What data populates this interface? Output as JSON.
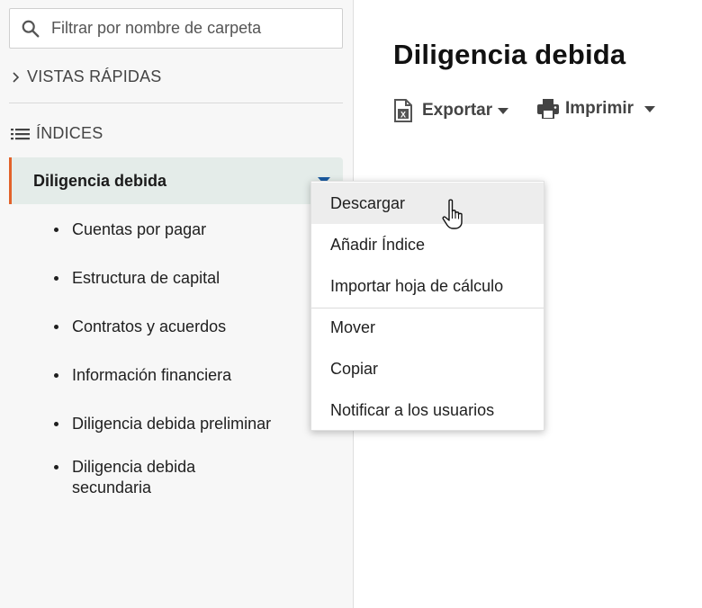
{
  "sidebar": {
    "search": {
      "placeholder": "Filtrar por nombre de carpeta",
      "icon": "search-icon"
    },
    "quick_views_label": "VISTAS RÁPIDAS",
    "indices_label": "ÍNDICES",
    "active_folder": "Diligencia debida",
    "subfolders": [
      "Cuentas por pagar",
      "Estructura de capital",
      "Contratos y acuerdos",
      "Información financiera",
      "Diligencia debida preliminar",
      "Diligencia debida secundaria"
    ]
  },
  "main": {
    "title": "Diligencia debida",
    "toolbar": {
      "export_label": "Exportar",
      "print_label": "Imprimir"
    }
  },
  "context_menu": {
    "items": [
      "Descargar",
      "Añadir Índice",
      "Importar hoja de cálculo",
      "Mover",
      "Copiar",
      "Notificar a los usuarios"
    ],
    "hovered_item": "Descargar"
  },
  "colors": {
    "accent": "#e2622a",
    "active_bg": "#e4ece9",
    "caret_blue": "#1a5aa0"
  }
}
